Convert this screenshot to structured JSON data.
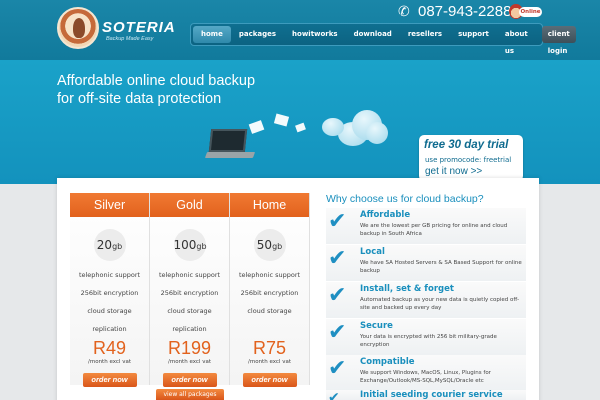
{
  "header": {
    "brand": "SOTERIA",
    "tagline": "Backup Made Easy",
    "phone": "087-943-2288",
    "online_label": "Online",
    "nav": [
      {
        "label": "home"
      },
      {
        "label": "packages"
      },
      {
        "label": "howitworks"
      },
      {
        "label": "download"
      },
      {
        "label": "resellers"
      },
      {
        "label": "support"
      },
      {
        "label": "about us"
      },
      {
        "label": "client login"
      }
    ]
  },
  "hero": {
    "headline_1": "Affordable online cloud backup",
    "headline_2": "for off-site data protection",
    "trial_title": "free 30 day trial",
    "trial_promo": "use promocode: freetrial",
    "trial_link": "get it now >>"
  },
  "packages": [
    {
      "name": "Silver",
      "size": "20",
      "unit": "gb",
      "support": "telephonic support",
      "encryption": "256bit encryption",
      "storage": "cloud storage",
      "replication": "replication",
      "price": "R49",
      "note": "/month excl vat",
      "order": "order now"
    },
    {
      "name": "Gold",
      "size": "100",
      "unit": "gb",
      "support": "telephonic support",
      "encryption": "256bit encryption",
      "storage": "cloud storage",
      "replication": "replication",
      "price": "R199",
      "note": "/month excl vat",
      "order": "order now"
    },
    {
      "name": "Home",
      "size": "50",
      "unit": "gb",
      "support": "telephonic support",
      "encryption": "256bit encryption",
      "storage": "cloud storage",
      "replication": "",
      "price": "R75",
      "note": "/month excl vat",
      "order": "order now"
    }
  ],
  "view_all": "view all packages",
  "why": {
    "title": "Why choose us for cloud backup?",
    "features": [
      {
        "title": "Affordable",
        "desc": "We are the lowest per GB pricing for online and cloud backup in South Africa"
      },
      {
        "title": "Local",
        "desc": "We have SA Hosted Servers & SA Based Support for online backup"
      },
      {
        "title": "Install, set & forget",
        "desc": "Automated backup as your new data is quietly copied off-site and backed up every day"
      },
      {
        "title": "Secure",
        "desc": "Your data is encrypted with 256 bit military-grade encryption"
      },
      {
        "title": "Compatible",
        "desc": "We support Windows, MacOS, Linux, Plugins for Exchange/Outlook/MS-SQL,MySQL/Oracle etc"
      },
      {
        "title": "Initial seeding courier service",
        "desc": ""
      }
    ]
  }
}
